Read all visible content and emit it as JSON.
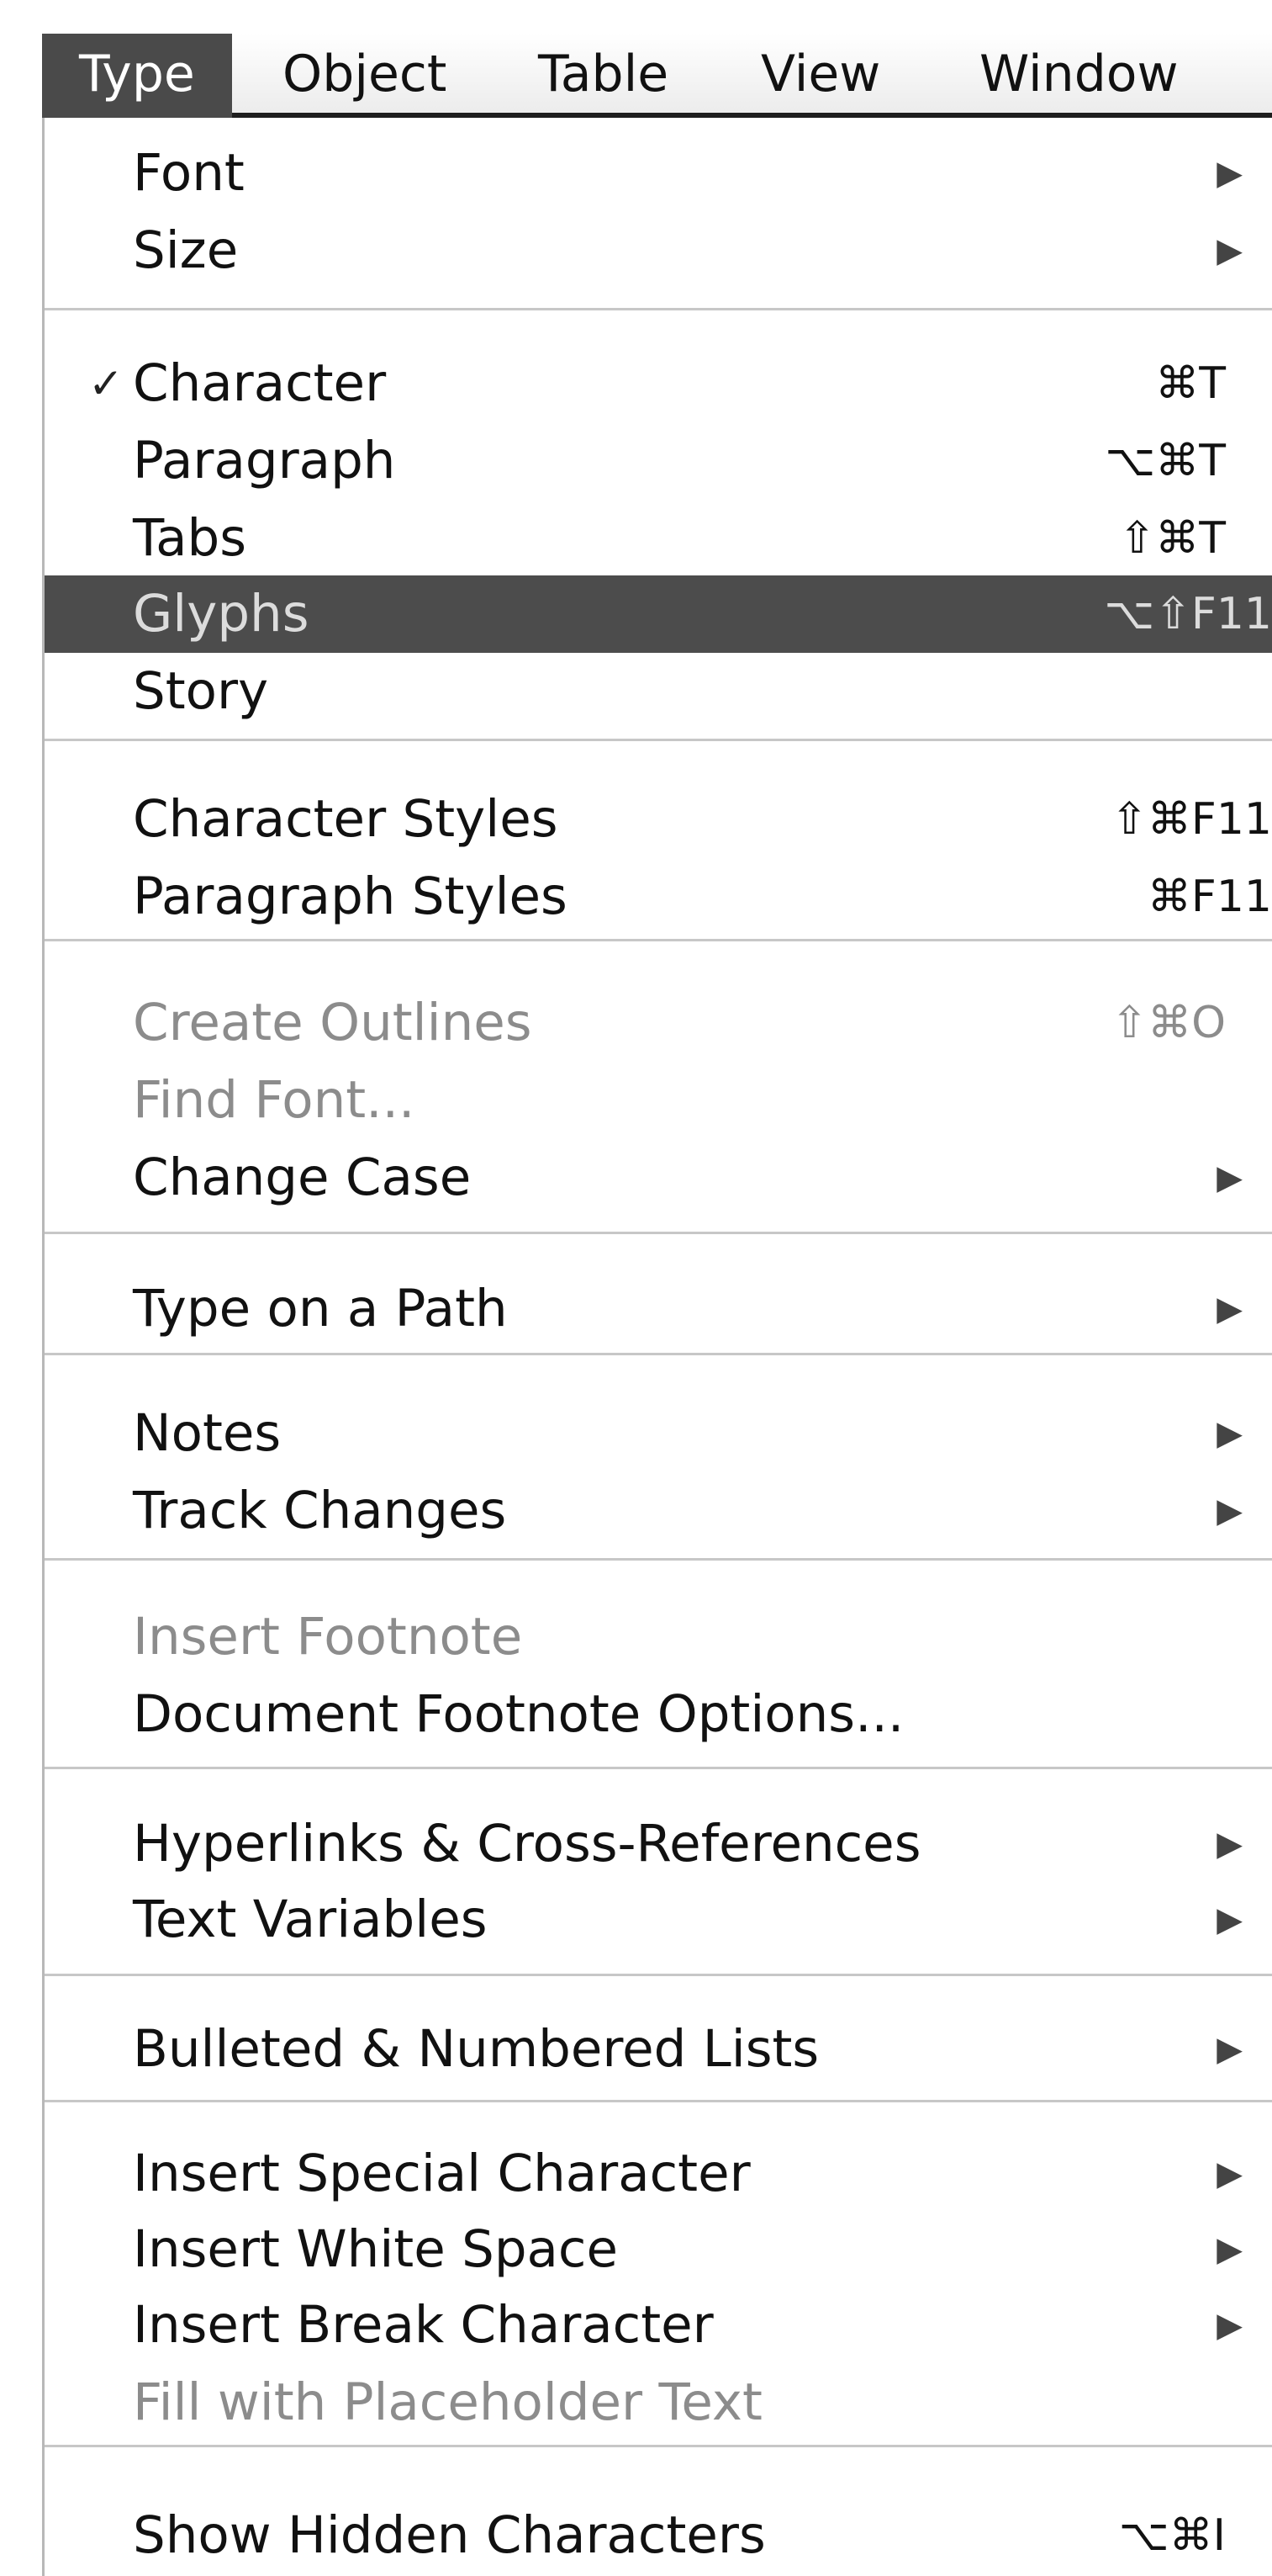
{
  "menubar": {
    "items": [
      {
        "label": "Type",
        "active": true
      },
      {
        "label": "Object"
      },
      {
        "label": "Table"
      },
      {
        "label": "View"
      },
      {
        "label": "Window"
      }
    ]
  },
  "menu": {
    "groups": [
      [
        {
          "label": "Font",
          "submenu": true
        },
        {
          "label": "Size",
          "submenu": true
        }
      ],
      [
        {
          "label": "Character",
          "checked": true,
          "shortcut": "⌘T"
        },
        {
          "label": "Paragraph",
          "shortcut": "⌥⌘T"
        },
        {
          "label": "Tabs",
          "shortcut": "⇧⌘T"
        },
        {
          "label": "Glyphs",
          "shortcut": "⌥⇧F11",
          "highlighted": true
        },
        {
          "label": "Story"
        }
      ],
      [
        {
          "label": "Character Styles",
          "shortcut": "⇧⌘F11"
        },
        {
          "label": "Paragraph Styles",
          "shortcut": "⌘F11"
        }
      ],
      [
        {
          "label": "Create Outlines",
          "shortcut": "⇧⌘O",
          "disabled": true
        },
        {
          "label": "Find Font...",
          "disabled": true
        },
        {
          "label": "Change Case",
          "submenu": true
        }
      ],
      [
        {
          "label": "Type on a Path",
          "submenu": true
        }
      ],
      [
        {
          "label": "Notes",
          "submenu": true
        },
        {
          "label": "Track Changes",
          "submenu": true
        }
      ],
      [
        {
          "label": "Insert Footnote",
          "disabled": true
        },
        {
          "label": "Document Footnote Options..."
        }
      ],
      [
        {
          "label": "Hyperlinks & Cross-References",
          "submenu": true
        },
        {
          "label": "Text Variables",
          "submenu": true
        }
      ],
      [
        {
          "label": "Bulleted & Numbered Lists",
          "submenu": true
        }
      ],
      [
        {
          "label": "Insert Special Character",
          "submenu": true
        },
        {
          "label": "Insert White Space",
          "submenu": true
        },
        {
          "label": "Insert Break Character",
          "submenu": true
        },
        {
          "label": "Fill with Placeholder Text",
          "disabled": true
        }
      ],
      [
        {
          "label": "Show Hidden Characters",
          "shortcut": "⌥⌘I"
        }
      ]
    ]
  },
  "icons": {
    "check": "checkmark-icon",
    "submenu": "submenu-arrow-icon"
  },
  "colors": {
    "highlight": "#4c4c4c",
    "disabled_text": "#8c8c8c",
    "separator": "#c7c7c7"
  }
}
